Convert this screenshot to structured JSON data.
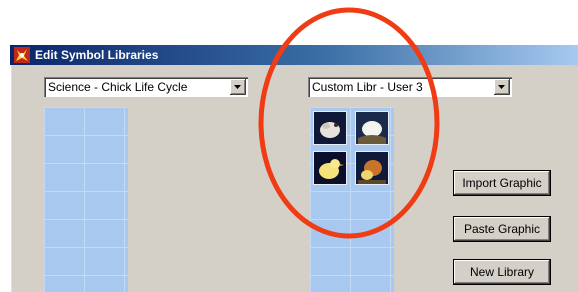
{
  "window": {
    "title": "Edit Symbol Libraries",
    "icon": "app-logo-icon"
  },
  "left_panel": {
    "library_select": {
      "value": "Science - Chick Life Cycle"
    }
  },
  "right_panel": {
    "library_select": {
      "value": "Custom Libr - User 3"
    },
    "symbols": [
      {
        "name": "chick-egg-image"
      },
      {
        "name": "white-egg-image"
      },
      {
        "name": "yellow-chick-image"
      },
      {
        "name": "chick-with-hen-image"
      }
    ]
  },
  "buttons": {
    "import_graphic": "Import Graphic",
    "paste_graphic": "Paste Graphic",
    "new_library": "New Library"
  },
  "annotation": {
    "color": "#f03c14",
    "shape": "ellipse"
  }
}
